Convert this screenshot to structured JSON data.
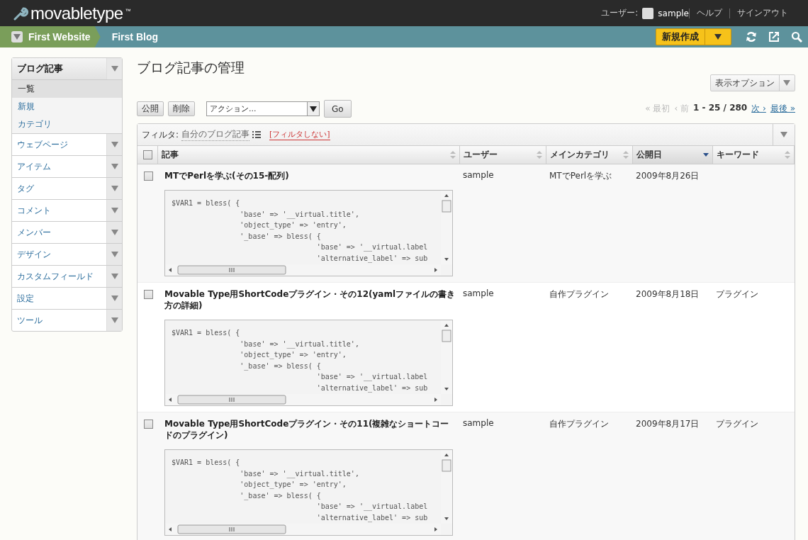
{
  "header": {
    "logo": "movabletype",
    "logo_mark": "™",
    "user_label": "ユーザー:",
    "user_name": "sample",
    "links": [
      "ヘルプ",
      "サインアウト"
    ]
  },
  "nav": {
    "website": "First Website",
    "blog": "First Blog",
    "new_button": "新規作成"
  },
  "sidebar": [
    {
      "label": "ブログ記事",
      "expanded": true,
      "children": [
        {
          "label": "一覧",
          "selected": true
        },
        {
          "label": "新規",
          "selected": false
        },
        {
          "label": "カテゴリ",
          "selected": false
        }
      ]
    },
    {
      "label": "ウェブページ",
      "expanded": false
    },
    {
      "label": "アイテム",
      "expanded": false
    },
    {
      "label": "タグ",
      "expanded": false
    },
    {
      "label": "コメント",
      "expanded": false
    },
    {
      "label": "メンバー",
      "expanded": false
    },
    {
      "label": "デザイン",
      "expanded": false
    },
    {
      "label": "カスタムフィールド",
      "expanded": false
    },
    {
      "label": "設定",
      "expanded": false
    },
    {
      "label": "ツール",
      "expanded": false
    }
  ],
  "page_title": "ブログ記事の管理",
  "display_options": "表示オプション",
  "actions": {
    "buttons": [
      "公開",
      "削除"
    ],
    "select": "アクション...",
    "go": "Go"
  },
  "pagination": [
    {
      "text": "« 最初",
      "kind": "disabled"
    },
    {
      "text": "‹ 前",
      "kind": "disabled"
    },
    {
      "text": "1 - 25 / 280",
      "kind": "current"
    },
    {
      "text": "次 ›",
      "kind": "link"
    },
    {
      "text": "最後 »",
      "kind": "link"
    }
  ],
  "filter": {
    "label": "フィルタ:",
    "value": "自分のブログ記事",
    "clear": "[フィルタしない]"
  },
  "table": {
    "select_all_checked": false,
    "columns": [
      {
        "label": "記事",
        "sorted": false
      },
      {
        "label": "ユーザー",
        "sorted": false
      },
      {
        "label": "メインカテゴリ",
        "sorted": false
      },
      {
        "label": "公開日",
        "sorted": true
      },
      {
        "label": "キーワード",
        "sorted": false
      }
    ],
    "rows": [
      {
        "checked": false,
        "title": "MTでPerlを学ぶ(その15‐配列)",
        "user": "sample",
        "category": "MTでPerlを学ぶ",
        "date": "2009年8月26日",
        "code": [
          "$VAR1 = bless( {",
          "                'base' => '__virtual.title',",
          "                'object_type' => 'entry',",
          "                '_base' => bless( {",
          "                                  'base' => '__virtual.label",
          "                                  'alternative_label' => sub"
        ]
      },
      {
        "checked": false,
        "title": "Movable Type用ShortCodeプラグイン・その12(yamlファイルの書き方の詳細)",
        "user": "sample",
        "category": "自作プラグイン",
        "date": "2009年8月18日",
        "keyword": "プラグイン",
        "code": [
          "$VAR1 = bless( {",
          "                'base' => '__virtual.title',",
          "                'object_type' => 'entry',",
          "                '_base' => bless( {",
          "                                  'base' => '__virtual.label",
          "                                  'alternative_label' => sub"
        ]
      },
      {
        "checked": false,
        "title": "Movable Type用ShortCodeプラグイン・その11(複雑なショートコードのプラグイン)",
        "user": "sample",
        "category": "自作プラグイン",
        "date": "2009年8月17日",
        "keyword": "プラグイン",
        "code": [
          "$VAR1 = bless( {",
          "                'base' => '__virtual.title',",
          "                'object_type' => 'entry',",
          "                '_base' => bless( {",
          "                                  'base' => '__virtual.label",
          "                                  'alternative_label' => sub"
        ]
      }
    ]
  }
}
